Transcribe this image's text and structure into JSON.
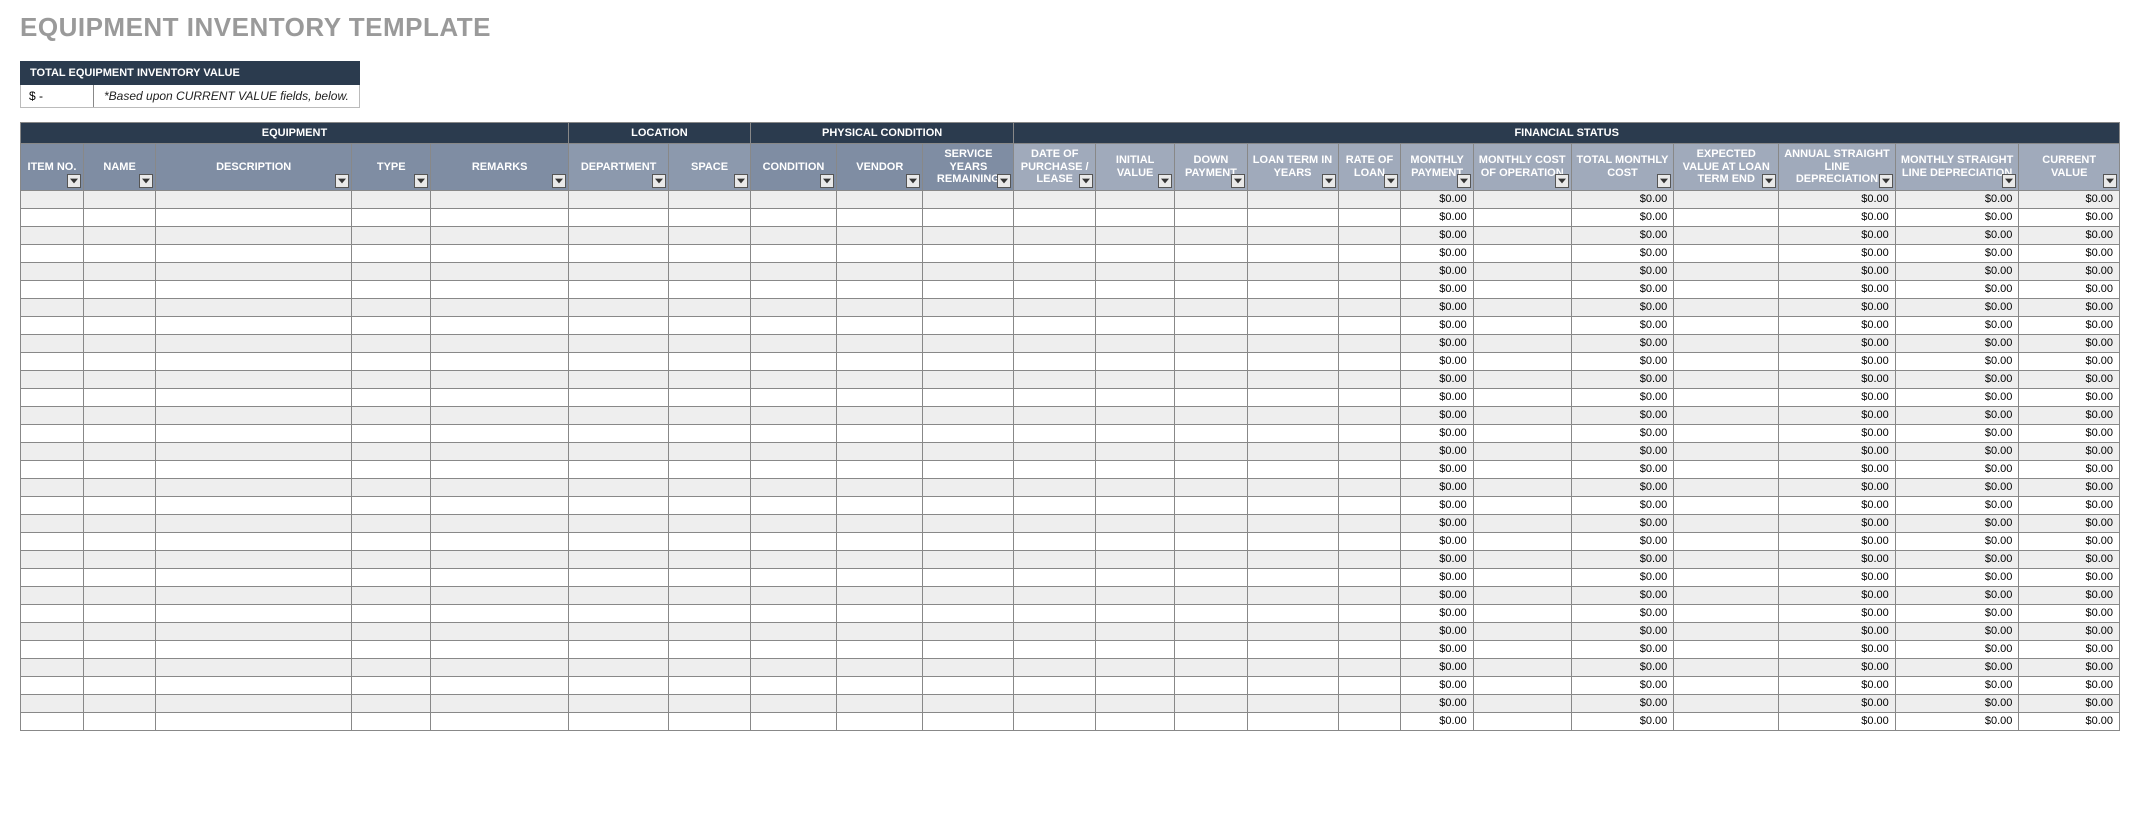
{
  "title": "EQUIPMENT INVENTORY TEMPLATE",
  "summary": {
    "header": "TOTAL EQUIPMENT INVENTORY VALUE",
    "value": "$        -",
    "note": "*Based upon CURRENT VALUE fields, below."
  },
  "groups": [
    {
      "label": "EQUIPMENT",
      "span": 5
    },
    {
      "label": "LOCATION",
      "span": 2
    },
    {
      "label": "PHYSICAL CONDITION",
      "span": 3
    },
    {
      "label": "FINANCIAL STATUS",
      "span": 12
    }
  ],
  "columns": [
    {
      "key": "item_no",
      "label": "ITEM NO.",
      "tone": "base"
    },
    {
      "key": "name",
      "label": "NAME",
      "tone": "base"
    },
    {
      "key": "description",
      "label": "DESCRIPTION",
      "tone": "base"
    },
    {
      "key": "type",
      "label": "TYPE",
      "tone": "base"
    },
    {
      "key": "remarks",
      "label": "REMARKS",
      "tone": "base"
    },
    {
      "key": "department",
      "label": "DEPARTMENT",
      "tone": "lighter"
    },
    {
      "key": "space",
      "label": "SPACE",
      "tone": "lighter"
    },
    {
      "key": "condition",
      "label": "CONDITION",
      "tone": "base"
    },
    {
      "key": "vendor",
      "label": "VENDOR",
      "tone": "base"
    },
    {
      "key": "service_years",
      "label": "SERVICE YEARS REMAINING",
      "tone": "base"
    },
    {
      "key": "date_purchase",
      "label": "DATE OF PURCHASE / LEASE",
      "tone": "lightest"
    },
    {
      "key": "initial_value",
      "label": "INITIAL VALUE",
      "tone": "lightest"
    },
    {
      "key": "down_payment",
      "label": "DOWN PAYMENT",
      "tone": "lightest"
    },
    {
      "key": "loan_term",
      "label": "LOAN TERM IN YEARS",
      "tone": "lightest"
    },
    {
      "key": "rate_loan",
      "label": "RATE OF LOAN",
      "tone": "lightest"
    },
    {
      "key": "monthly_payment",
      "label": "MONTHLY PAYMENT",
      "tone": "lightest"
    },
    {
      "key": "monthly_cost_op",
      "label": "MONTHLY COST OF OPERATION",
      "tone": "lightest"
    },
    {
      "key": "total_monthly_cost",
      "label": "TOTAL MONTHLY COST",
      "tone": "lightest"
    },
    {
      "key": "expected_value",
      "label": "EXPECTED VALUE AT LOAN TERM END",
      "tone": "lightest"
    },
    {
      "key": "annual_depr",
      "label": "ANNUAL STRAIGHT LINE DEPRECIATION",
      "tone": "lightest"
    },
    {
      "key": "monthly_depr",
      "label": "MONTHLY STRAIGHT LINE DEPRECIATION",
      "tone": "lightest"
    },
    {
      "key": "current_value",
      "label": "CURRENT VALUE",
      "tone": "lightest"
    }
  ],
  "calc_columns": [
    "monthly_payment",
    "total_monthly_cost",
    "annual_depr",
    "monthly_depr",
    "current_value"
  ],
  "default_calc_value": "$0.00",
  "row_count": 30,
  "col_classes": [
    "c-item",
    "c-name",
    "c-desc",
    "c-type",
    "c-rem",
    "c-dept",
    "c-space",
    "c-cond",
    "c-vend",
    "c-svc",
    "c-date",
    "c-ival",
    "c-down",
    "c-term",
    "c-rate",
    "c-mpay",
    "c-mcop",
    "c-tmc",
    "c-eval",
    "c-asd",
    "c-msd",
    "c-cur"
  ]
}
